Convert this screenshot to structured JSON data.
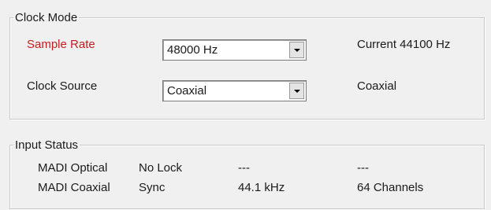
{
  "clock_mode": {
    "legend": "Clock Mode",
    "sample_rate": {
      "label": "Sample Rate",
      "label_color": "#c41e1e",
      "selected": "48000 Hz",
      "current_text": "Current  44100 Hz"
    },
    "clock_source": {
      "label": "Clock Source",
      "selected": "Coaxial",
      "current_text": "Coaxial"
    }
  },
  "input_status": {
    "legend": "Input Status",
    "rows": [
      {
        "name": "MADI Optical",
        "lock": "No Lock",
        "rate": "---",
        "channels": "---"
      },
      {
        "name": "MADI Coaxial",
        "lock": "Sync",
        "rate": "44.1 kHz",
        "channels": "64 Channels"
      }
    ]
  },
  "icons": {
    "dropdown": "chevron-down-icon"
  }
}
